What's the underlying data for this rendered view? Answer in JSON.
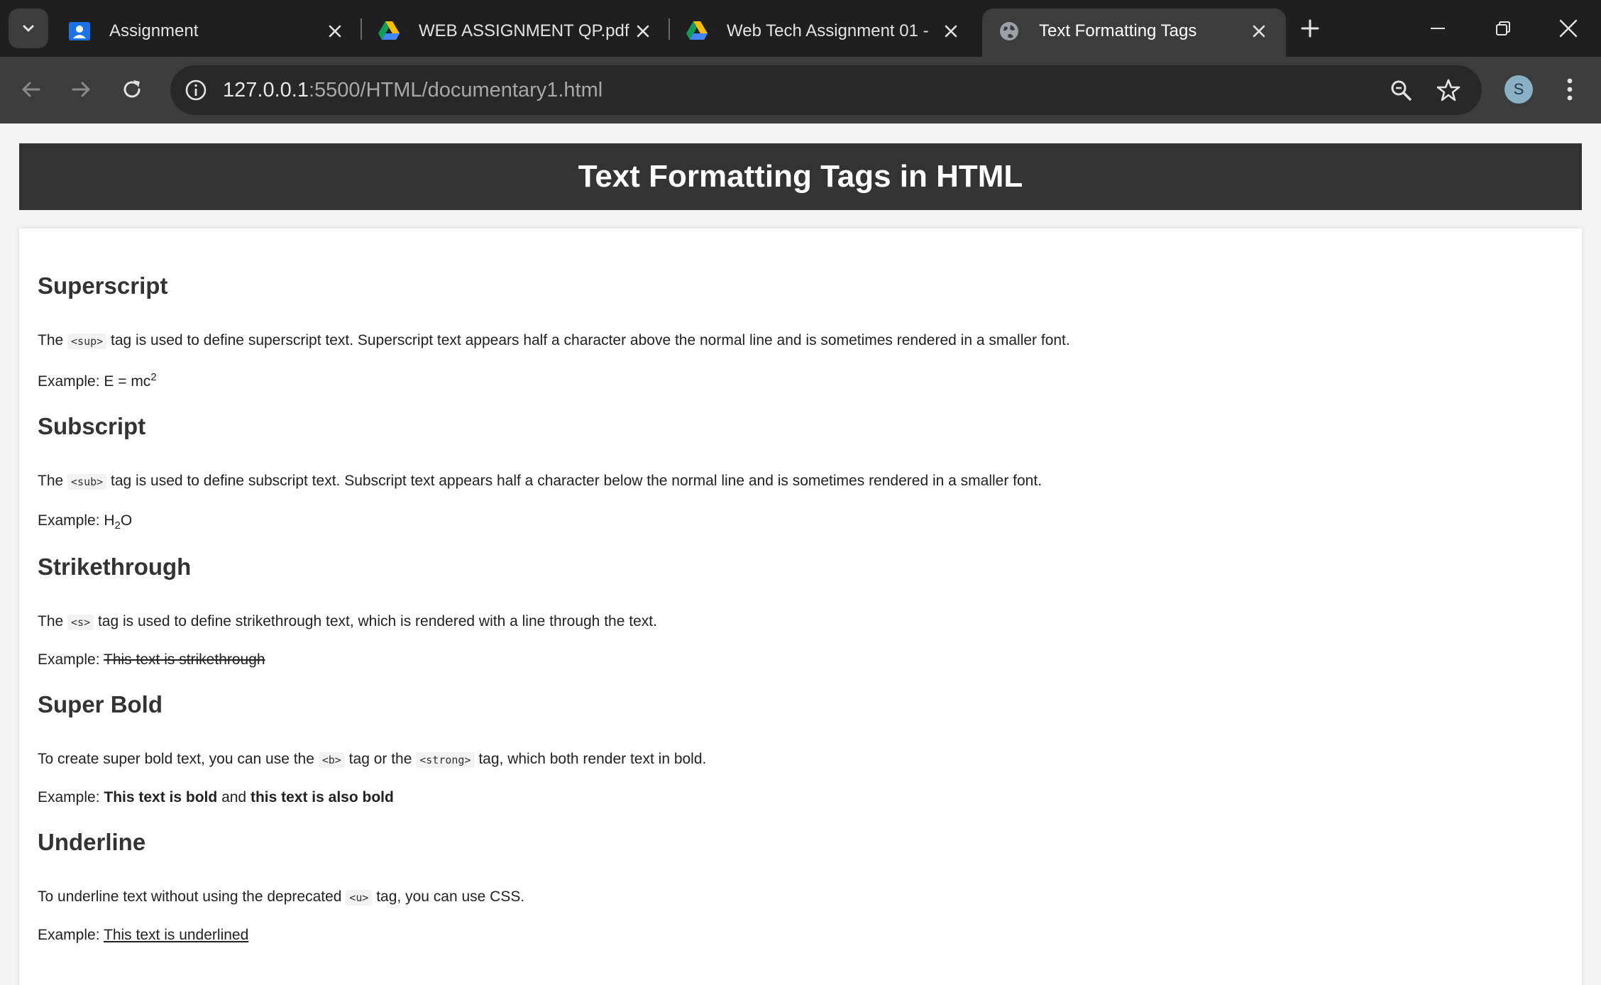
{
  "browser": {
    "tabs": [
      {
        "title": "Assignment",
        "icon": "google-classroom-icon",
        "active": false
      },
      {
        "title": "WEB ASSIGNMENT QP.pdf - ",
        "icon": "google-drive-icon",
        "active": false
      },
      {
        "title": "Web Tech Assignment 01 - ",
        "icon": "google-drive-icon",
        "active": false
      },
      {
        "title": "Text Formatting Tags",
        "icon": "globe-icon",
        "active": true
      }
    ],
    "address": {
      "host": "127.0.0.1",
      "path": ":5500/HTML/documentary1.html"
    },
    "profile_initial": "S"
  },
  "page": {
    "heading": "Text Formatting Tags in HTML",
    "sections": {
      "superscript": {
        "title": "Superscript",
        "desc_pre": "The ",
        "tag": "<sup>",
        "desc_post": " tag is used to define superscript text. Superscript text appears half a character above the normal line and is sometimes rendered in a smaller font.",
        "example_label": "Example: ",
        "example_base": "E = mc",
        "example_sup": "2"
      },
      "subscript": {
        "title": "Subscript",
        "desc_pre": "The ",
        "tag": "<sub>",
        "desc_post": " tag is used to define subscript text. Subscript text appears half a character below the normal line and is sometimes rendered in a smaller font.",
        "example_label": "Example: ",
        "example_base": "H",
        "example_sub": "2",
        "example_tail": "O"
      },
      "strikethrough": {
        "title": "Strikethrough",
        "desc_pre": "The ",
        "tag": "<s>",
        "desc_post": " tag is used to define strikethrough text, which is rendered with a line through the text.",
        "example_label": "Example: ",
        "example_text": "This text is strikethrough"
      },
      "superbold": {
        "title": "Super Bold",
        "desc_pre": "To create super bold text, you can use the ",
        "tag1": "<b>",
        "desc_mid": " tag or the ",
        "tag2": "<strong>",
        "desc_post": " tag, which both render text in bold.",
        "example_label": "Example: ",
        "example_bold1": "This text is bold",
        "example_mid": " and ",
        "example_bold2": "this text is also bold"
      },
      "underline": {
        "title": "Underline",
        "desc_pre": "To underline text without using the deprecated ",
        "tag": "<u>",
        "desc_post": " tag, you can use CSS.",
        "example_label": "Example: ",
        "example_text": "This text is underlined"
      }
    }
  },
  "colors": {
    "tabstrip_bg": "#1f1f1f",
    "toolbar_bg": "#3c3c3c",
    "page_bg": "#f4f4f4",
    "header_bg": "#333333",
    "content_bg": "#ffffff"
  }
}
